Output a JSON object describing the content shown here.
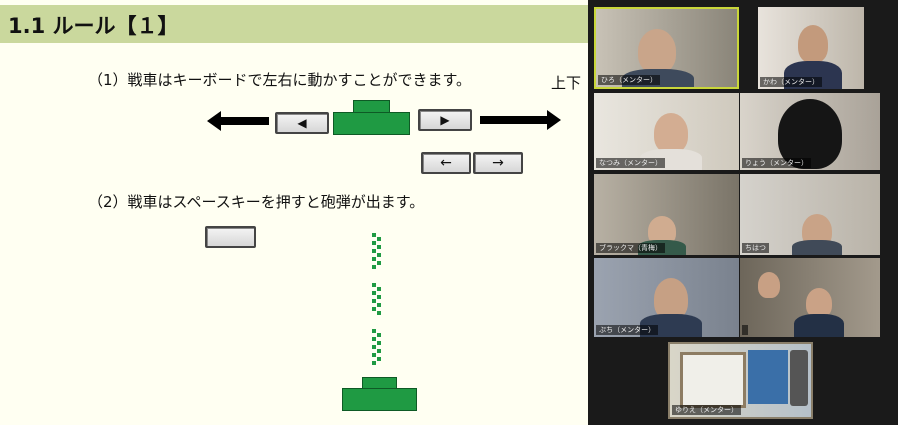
{
  "slide": {
    "title": "1.1 ルール【１】",
    "line1": "（1）戦車はキーボードで左右に動かすことができます。",
    "line1_tail": "上下",
    "line2": "（2）戦車はスペースキーを押すと砲弾が出ます。",
    "keys": {
      "left_key": "◀",
      "right_key": "▶",
      "arrow_left_key": "←",
      "arrow_right_key": "→",
      "space_key": ""
    },
    "colors": {
      "tank": "#1f9a43",
      "title_bar": "#cad89d",
      "background": "#fffff2"
    }
  },
  "gallery": {
    "participants": [
      {
        "name": "ひろ（メンター）",
        "active": true
      },
      {
        "name": "かわ（メンター）"
      },
      {
        "name": "なつみ（メンター）"
      },
      {
        "name": "りょう（メンター）"
      },
      {
        "name": "ブラックマ（青梅）"
      },
      {
        "name": "ちはつ"
      },
      {
        "name": "ぷち（メンター）"
      },
      {
        "name": ""
      },
      {
        "name": "ゆりえ（メンター）"
      }
    ]
  }
}
